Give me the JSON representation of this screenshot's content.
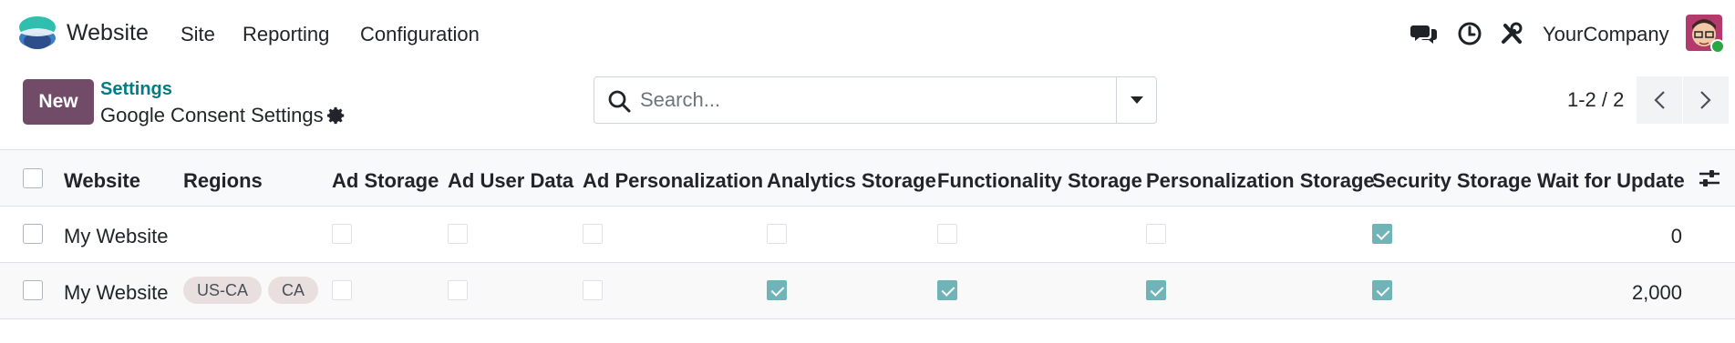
{
  "navbar": {
    "app_name": "Website",
    "menu": [
      "Site",
      "Reporting",
      "Configuration"
    ],
    "company": "YourCompany",
    "icons": [
      "chat-icon",
      "activity-clock-icon",
      "debug-tools-icon"
    ]
  },
  "control_panel": {
    "new_label": "New",
    "breadcrumb": "Settings",
    "title": "Google Consent Settings",
    "search_placeholder": "Search...",
    "pager": "1-2 / 2"
  },
  "table": {
    "columns": [
      "Website",
      "Regions",
      "Ad Storage",
      "Ad User Data",
      "Ad Personalization",
      "Analytics Storage",
      "Functionality Storage",
      "Personalization Storage",
      "Security Storage",
      "Wait for Update"
    ],
    "rows": [
      {
        "website": "My Website",
        "regions": [],
        "ad_storage": false,
        "ad_user_data": false,
        "ad_personalization": false,
        "analytics_storage": false,
        "functionality_storage": false,
        "personalization_storage": false,
        "security_storage": true,
        "wait_for_update": "0"
      },
      {
        "website": "My Website",
        "regions": [
          "US-CA",
          "CA"
        ],
        "ad_storage": false,
        "ad_user_data": false,
        "ad_personalization": false,
        "analytics_storage": true,
        "functionality_storage": true,
        "personalization_storage": true,
        "security_storage": true,
        "wait_for_update": "2,000"
      }
    ]
  },
  "colors": {
    "brand": "#714b67",
    "link": "#017e84",
    "check": "#71b4b8",
    "tag_bg": "#e9dfdf"
  }
}
